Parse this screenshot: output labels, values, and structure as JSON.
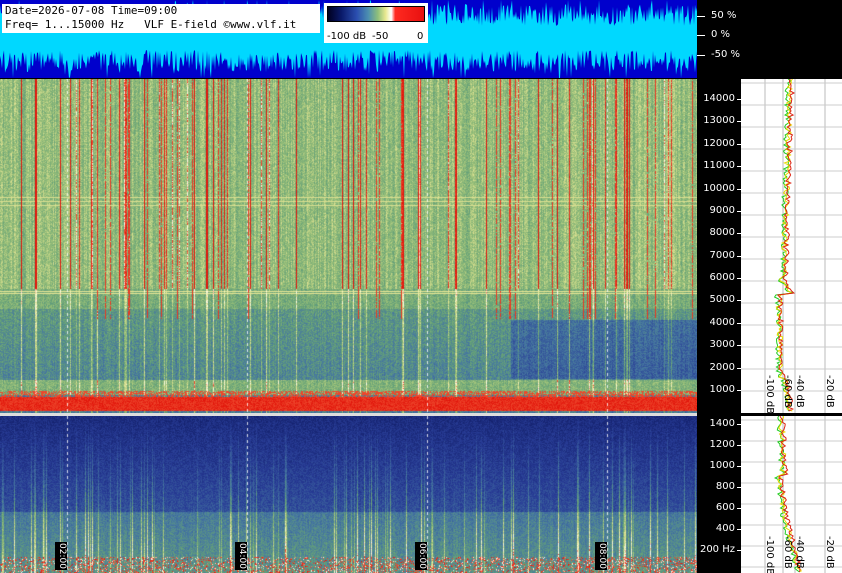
{
  "header": {
    "line1": "Date=2026-07-08 Time=09:00",
    "line2": "Freq= 1...15000 Hz   VLF E-field ©www.vlf.it"
  },
  "colorbar": {
    "labels": [
      "-100 dB",
      "-50",
      "0"
    ]
  },
  "waveform_scale": [
    "50 %",
    "0 %",
    "-50 %"
  ],
  "freq_axis_top": [
    "14000",
    "13000",
    "12000",
    "11000",
    "10000",
    "9000",
    "8000",
    "7000",
    "6000",
    "5000",
    "4000",
    "3000",
    "2000",
    "1000"
  ],
  "freq_axis_bottom": [
    "1400",
    "1200",
    "1000",
    "800",
    "600",
    "400",
    "200 Hz"
  ],
  "profile_db_labels_top": [
    "-100 dB",
    "-60 dB",
    "-40 dB",
    "-20 dB"
  ],
  "profile_db_labels_bottom": [
    "-100 dB",
    "-60 dB",
    "-40 dB",
    "-20 dB"
  ],
  "hour_marks": [
    "02:00",
    "04:00",
    "06:00",
    "08:00"
  ],
  "colors": {
    "waveform_bg": "#0000cc",
    "waveform_signal": "#00d8ff",
    "spectrum_green": "#5f9e7a",
    "spectrum_blue": "#2a3f8f",
    "spectrum_red": "#e81a10",
    "profile_green": "#22cc22",
    "profile_red": "#dd2211",
    "profile_yellow": "#e8d800"
  }
}
